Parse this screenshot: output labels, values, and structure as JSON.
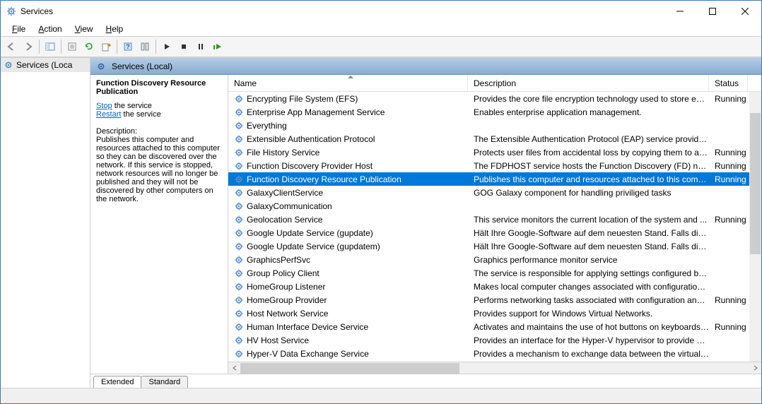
{
  "window": {
    "title": "Services"
  },
  "menu": {
    "file": "File",
    "action": "Action",
    "view": "View",
    "help": "Help"
  },
  "tree": {
    "root": "Services (Loca"
  },
  "header": {
    "title": "Services (Local)"
  },
  "detail": {
    "service_name": "Function Discovery Resource Publication",
    "stop_link": "Stop",
    "stop_suffix": " the service",
    "restart_link": "Restart",
    "restart_suffix": " the service",
    "desc_label": "Description:",
    "desc_text": "Publishes this computer and resources attached to this computer so they can be discovered over the network.  If this service is stopped, network resources will no longer be published and they will not be discovered by other computers on the network."
  },
  "columns": {
    "name": "Name",
    "description": "Description",
    "status": "Status"
  },
  "services": [
    {
      "name": "Encrypting File System (EFS)",
      "desc": "Provides the core file encryption technology used to store enc...",
      "status": "Running"
    },
    {
      "name": "Enterprise App Management Service",
      "desc": "Enables enterprise application management.",
      "status": ""
    },
    {
      "name": "Everything",
      "desc": "",
      "status": ""
    },
    {
      "name": "Extensible Authentication Protocol",
      "desc": "The Extensible Authentication Protocol (EAP) service provides ...",
      "status": ""
    },
    {
      "name": "File History Service",
      "desc": "Protects user files from accidental loss by copying them to a b...",
      "status": "Running"
    },
    {
      "name": "Function Discovery Provider Host",
      "desc": "The FDPHOST service hosts the Function Discovery (FD) netw...",
      "status": "Running"
    },
    {
      "name": "Function Discovery Resource Publication",
      "desc": "Publishes this computer and resources attached to this comp...",
      "status": "Running",
      "selected": true
    },
    {
      "name": "GalaxyClientService",
      "desc": "GOG Galaxy component for handling priviliged tasks",
      "status": ""
    },
    {
      "name": "GalaxyCommunication",
      "desc": "",
      "status": ""
    },
    {
      "name": "Geolocation Service",
      "desc": "This service monitors the current location of the system and ...",
      "status": "Running"
    },
    {
      "name": "Google Update Service (gupdate)",
      "desc": "Hält Ihre Google-Software auf dem neuesten Stand. Falls diese...",
      "status": ""
    },
    {
      "name": "Google Update Service (gupdatem)",
      "desc": "Hält Ihre Google-Software auf dem neuesten Stand. Falls diese...",
      "status": ""
    },
    {
      "name": "GraphicsPerfSvc",
      "desc": "Graphics performance monitor service",
      "status": ""
    },
    {
      "name": "Group Policy Client",
      "desc": "The service is responsible for applying settings configured by ...",
      "status": ""
    },
    {
      "name": "HomeGroup Listener",
      "desc": "Makes local computer changes associated with configuration ...",
      "status": ""
    },
    {
      "name": "HomeGroup Provider",
      "desc": "Performs networking tasks associated with configuration and ...",
      "status": "Running"
    },
    {
      "name": "Host Network Service",
      "desc": "Provides support for Windows Virtual Networks.",
      "status": ""
    },
    {
      "name": "Human Interface Device Service",
      "desc": "Activates and maintains the use of hot buttons on keyboards, ...",
      "status": "Running"
    },
    {
      "name": "HV Host Service",
      "desc": "Provides an interface for the Hyper-V hypervisor to provide pe...",
      "status": ""
    },
    {
      "name": "Hyper-V Data Exchange Service",
      "desc": "Provides a mechanism to exchange data between the virtual ...",
      "status": ""
    }
  ],
  "tabs": {
    "extended": "Extended",
    "standard": "Standard"
  }
}
